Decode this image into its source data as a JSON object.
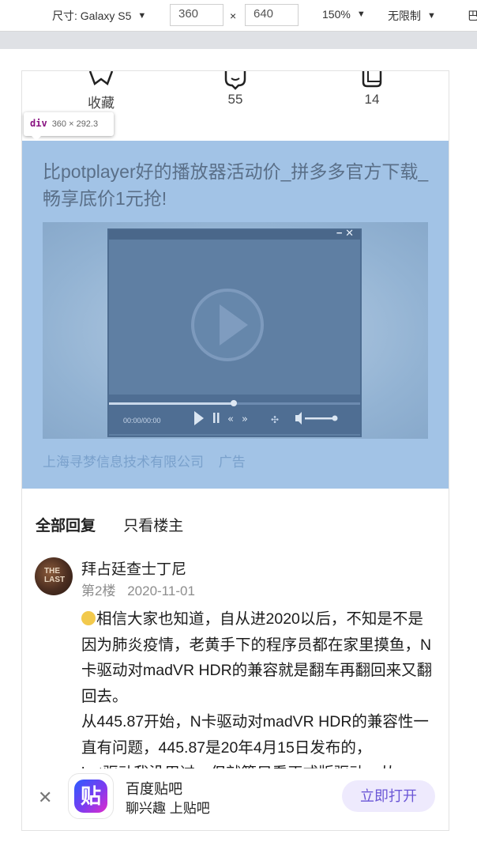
{
  "devtools": {
    "device_label": "尺寸: Galaxy S5",
    "width": "360",
    "separator": "×",
    "height": "640",
    "zoom": "150%",
    "throttle": "无限制",
    "overflow_text": "巴"
  },
  "stats": [
    {
      "icon": "star-icon",
      "label": "收藏"
    },
    {
      "icon": "comment-icon",
      "label": "55"
    },
    {
      "icon": "share-icon",
      "label": "14"
    }
  ],
  "inspector_tooltip": {
    "tag": "div",
    "size": "360 × 292.3"
  },
  "ad": {
    "title": "比potplayer好的播放器活动价_拼多多官方下载_畅享底价1元抢!",
    "player_time": "00:00/00:00",
    "advertiser": "上海寻梦信息技术有限公司",
    "ad_label": "广告"
  },
  "tabs": {
    "all_replies": "全部回复",
    "op_only": "只看楼主"
  },
  "post": {
    "author": "拜占廷查士丁尼",
    "floor": "第2楼",
    "date": "2020-11-01",
    "avatar_text": "THE LAST",
    "paragraph_1": "相信大家也知道，自从进2020以后，不知是不是因为肺炎疫情，老黄手下的程序员都在家里摸鱼，N卡驱动对madVR HDR的兼容就是翻车再翻回来又翻回去。",
    "paragraph_2": "从445.87开始，N卡驱动对madVR HDR的兼容性一直有问题，445.87是20年4月15日发布的，",
    "paragraph_3": "bet驱动我没用过，但就算只看正式版驱动，从"
  },
  "app_banner": {
    "close": "✕",
    "icon_text": "贴",
    "name": "百度贴吧",
    "slogan": "聊兴趣 上贴吧",
    "open_button": "立即打开"
  },
  "colors": {
    "ad_bg": "#a2c3e6",
    "ad_text": "#5a6f88",
    "button_bg": "#eeeafd",
    "button_text": "#6b57d6"
  }
}
